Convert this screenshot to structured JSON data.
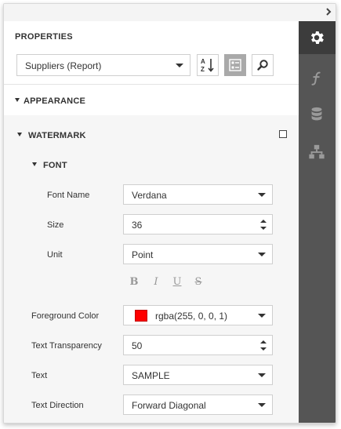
{
  "properties_title": "PROPERTIES",
  "report_select": {
    "value": "Suppliers (Report)"
  },
  "sections": {
    "appearance": "APPEARANCE",
    "watermark": "WATERMARK",
    "font": "FONT"
  },
  "fields": {
    "font_name": {
      "label": "Font Name",
      "value": "Verdana"
    },
    "size": {
      "label": "Size",
      "value": "36"
    },
    "unit": {
      "label": "Unit",
      "value": "Point"
    },
    "foreground_color": {
      "label": "Foreground Color",
      "value": "rgba(255, 0, 0, 1)",
      "swatch": "#ff0000"
    },
    "text_transparency": {
      "label": "Text Transparency",
      "value": "50"
    },
    "text": {
      "label": "Text",
      "value": "SAMPLE"
    },
    "text_direction": {
      "label": "Text Direction",
      "value": "Forward Diagonal"
    }
  },
  "format_buttons": {
    "bold": "B",
    "italic": "I",
    "underline": "U",
    "strikeout": "S"
  },
  "colors": {
    "sidebar": "#555555",
    "sidebar_active": "#3c3c3c",
    "toggle_active": "#a9a9a9"
  },
  "icons": {
    "sidebar": [
      "gear-icon",
      "function-icon",
      "database-icon",
      "hierarchy-icon"
    ],
    "toolbar": [
      "sort-alphabetical-icon",
      "categorized-icon",
      "search-icon"
    ]
  }
}
